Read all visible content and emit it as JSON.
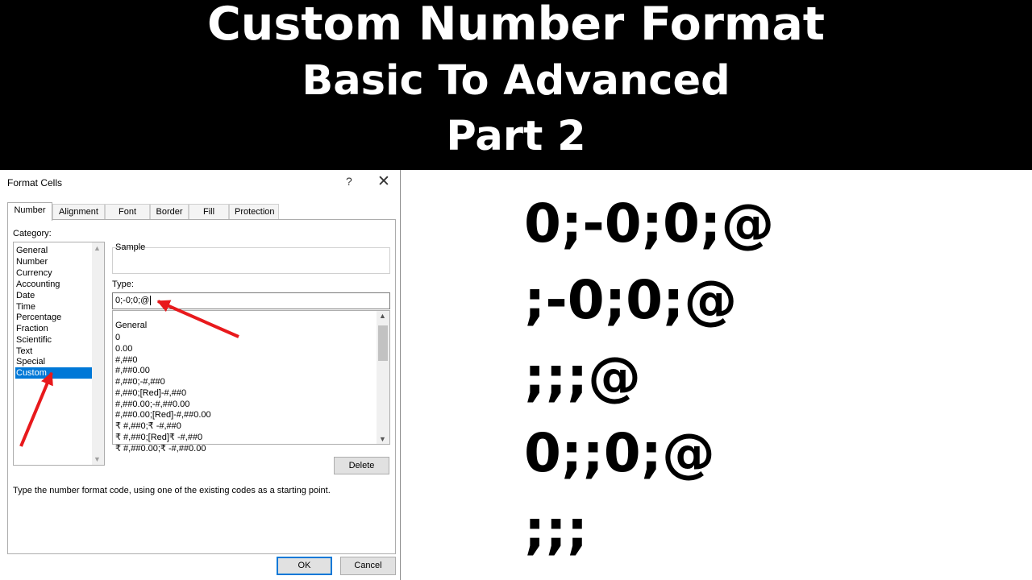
{
  "banner": {
    "line1": "Custom Number Format",
    "line2": "Basic To Advanced",
    "line3": "Part 2"
  },
  "dialog": {
    "title": "Format Cells",
    "help_icon": "?",
    "close_icon": "✕",
    "tabs": [
      "Number",
      "Alignment",
      "Font",
      "Border",
      "Fill",
      "Protection"
    ],
    "active_tab": "Number",
    "category_label": "Category:",
    "categories": [
      "General",
      "Number",
      "Currency",
      "Accounting",
      "Date",
      "Time",
      "Percentage",
      "Fraction",
      "Scientific",
      "Text",
      "Special",
      "Custom"
    ],
    "selected_category": "Custom",
    "sample_label": "Sample",
    "type_label": "Type:",
    "type_value": "0;-0;0;@",
    "formats": [
      "General",
      "0",
      "0.00",
      "#,##0",
      "#,##0.00",
      "#,##0;-#,##0",
      "#,##0;[Red]-#,##0",
      "#,##0.00;-#,##0.00",
      "#,##0.00;[Red]-#,##0.00",
      "₹ #,##0;₹ -#,##0",
      "₹ #,##0;[Red]₹ -#,##0",
      "₹ #,##0.00;₹ -#,##0.00"
    ],
    "delete_label": "Delete",
    "hint": "Type the number format code, using one of the existing codes as a starting point.",
    "ok_label": "OK",
    "cancel_label": "Cancel",
    "selection_color": "#0078d7",
    "arrow_color": "#e8191c"
  },
  "codes": [
    "0;-0;0;@",
    ";-0;0;@",
    ";;;@",
    "0;;0;@",
    ";;;"
  ]
}
